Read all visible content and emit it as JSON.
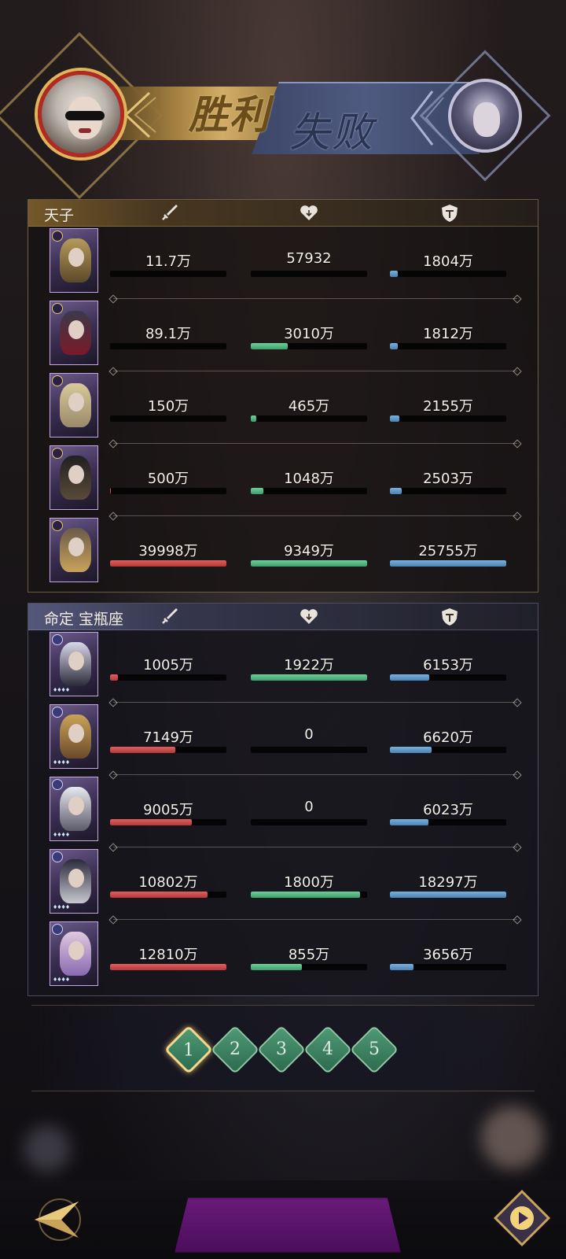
{
  "header": {
    "victory_label": "胜利",
    "defeat_label": "失败"
  },
  "teams": [
    {
      "name": "天子",
      "side": "victory",
      "players": [
        {
          "damage": "11.7万",
          "damage_pct": 0.0,
          "heal": "57932",
          "heal_pct": 0.0,
          "tank": "1804万",
          "tank_pct": 0.07
        },
        {
          "damage": "89.1万",
          "damage_pct": 0.0,
          "heal": "3010万",
          "heal_pct": 0.32,
          "tank": "1812万",
          "tank_pct": 0.07
        },
        {
          "damage": "150万",
          "damage_pct": 0.0,
          "heal": "465万",
          "heal_pct": 0.05,
          "tank": "2155万",
          "tank_pct": 0.08
        },
        {
          "damage": "500万",
          "damage_pct": 0.01,
          "heal": "1048万",
          "heal_pct": 0.11,
          "tank": "2503万",
          "tank_pct": 0.1
        },
        {
          "damage": "39998万",
          "damage_pct": 1.0,
          "heal": "9349万",
          "heal_pct": 1.0,
          "tank": "25755万",
          "tank_pct": 1.0
        }
      ]
    },
    {
      "name": "命定 宝瓶座",
      "side": "defeat",
      "players": [
        {
          "damage": "1005万",
          "damage_pct": 0.07,
          "heal": "1922万",
          "heal_pct": 1.0,
          "tank": "6153万",
          "tank_pct": 0.34
        },
        {
          "damage": "7149万",
          "damage_pct": 0.56,
          "heal": "0",
          "heal_pct": 0.0,
          "tank": "6620万",
          "tank_pct": 0.36
        },
        {
          "damage": "9005万",
          "damage_pct": 0.7,
          "heal": "0",
          "heal_pct": 0.0,
          "tank": "6023万",
          "tank_pct": 0.33
        },
        {
          "damage": "10802万",
          "damage_pct": 0.84,
          "heal": "1800万",
          "heal_pct": 0.94,
          "tank": "18297万",
          "tank_pct": 1.0
        },
        {
          "damage": "12810万",
          "damage_pct": 1.0,
          "heal": "855万",
          "heal_pct": 0.44,
          "tank": "3656万",
          "tank_pct": 0.2
        }
      ]
    }
  ],
  "rounds": {
    "labels": [
      "1",
      "2",
      "3",
      "4",
      "5"
    ],
    "active_index": 0
  },
  "icons": {
    "damage": "sword-icon",
    "heal": "heart-icon",
    "tank": "shield-icon",
    "back": "back-arrow-icon",
    "replay": "replay-icon"
  },
  "colors": {
    "damage_bar": "#c84848",
    "heal_bar": "#55b583",
    "tank_bar": "#5f97c6",
    "active_round_border": "#f1d98f"
  }
}
